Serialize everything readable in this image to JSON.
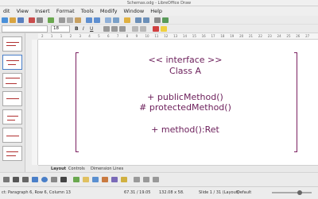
{
  "window": {
    "title": "Schemas.odg - LibreOffice Draw"
  },
  "menu": [
    "dit",
    "View",
    "Insert",
    "Format",
    "Tools",
    "Modify",
    "Window",
    "Help"
  ],
  "toolbar": {
    "font_name": "",
    "font_size": "18"
  },
  "ruler": {
    "ticks": [
      "2",
      "1",
      "1",
      "2",
      "3",
      "4",
      "5",
      "6",
      "7",
      "8",
      "9",
      "10",
      "11",
      "12",
      "13",
      "14",
      "15",
      "16",
      "17",
      "18",
      "19",
      "20",
      "21",
      "22",
      "23",
      "24",
      "25",
      "26",
      "27"
    ]
  },
  "canvas": {
    "lines": [
      "<< interface >>",
      "Class A",
      "+ publicMethod()",
      "# protectedMethod()",
      "+ method():Ret"
    ]
  },
  "tabs": {
    "layout": "Layout",
    "controls": "Controls",
    "dimension_lines": "Dimension Lines"
  },
  "status": {
    "edit_info": "ct: Paragraph 6, Row 6, Column 13",
    "position": "67.31 / 19.05",
    "size": "132.08 x 58.",
    "slide": "Slide 1 / 31 (Layout)",
    "layout_name": "Default"
  },
  "colors": {
    "text": "#6b1e5a",
    "bracket": "#7a2060"
  }
}
